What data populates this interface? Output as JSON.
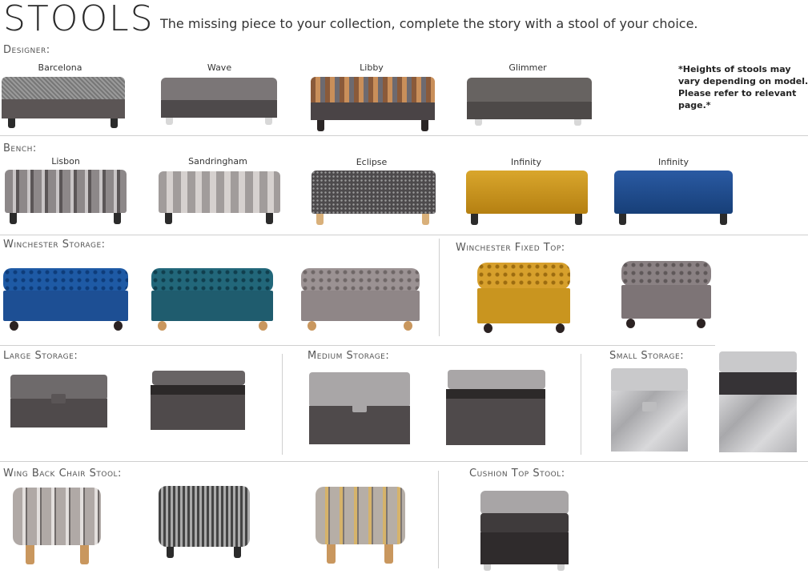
{
  "header": {
    "title": "STOOLS",
    "subtitle": "The missing piece to your collection, complete the story with a stool of your choice."
  },
  "note": {
    "line1": "*Heights of stools may",
    "line2": "vary depending on model.",
    "line3": "Please refer to relevant page.*"
  },
  "sections": {
    "designer": "Designer:",
    "bench": "Bench:",
    "winchester_storage": "Winchester Storage:",
    "winchester_fixed": "Winchester Fixed Top:",
    "large_storage": "Large Storage:",
    "medium_storage": "Medium Storage:",
    "small_storage": "Small Storage:",
    "wing_back": "Wing Back Chair Stool:",
    "cushion_top": "Cushion Top Stool:"
  },
  "designer_items": [
    "Barcelona",
    "Wave",
    "Libby",
    "Glimmer"
  ],
  "bench_items": [
    "Lisbon",
    "Sandringham",
    "Eclipse",
    "Infinity",
    "Infinity"
  ],
  "colors": {
    "charcoal": "#5a5556",
    "grey_fabric": "#7d7778",
    "navy": "#1f4a8a",
    "teal": "#1f5c6e",
    "mustard": "#c9951f",
    "silver": "#c9c9cb",
    "tartan": "#b8b1ae",
    "wood": "#c9975e"
  }
}
